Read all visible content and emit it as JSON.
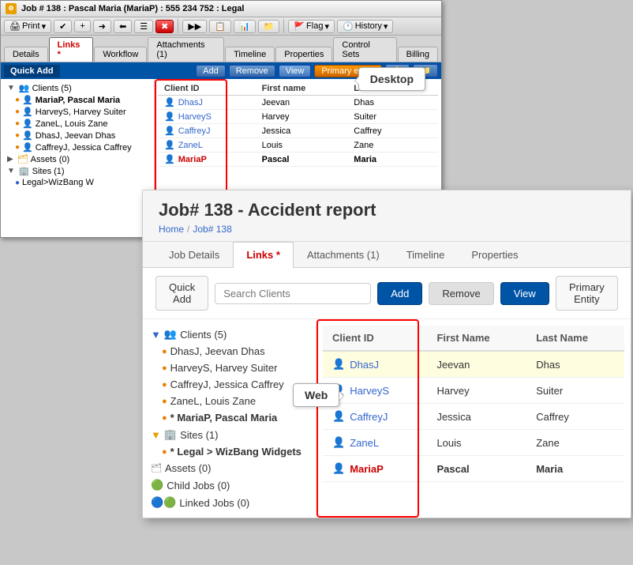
{
  "desktop": {
    "title": "Job # 138 : Pascal Maria (MariaP) : 555 234 752 : Legal",
    "toolbar": {
      "print": "Print",
      "flag": "Flag",
      "history": "History"
    },
    "tabs": [
      {
        "label": "Details",
        "active": false,
        "modified": false
      },
      {
        "label": "Links *",
        "active": true,
        "modified": true
      },
      {
        "label": "Workflow",
        "active": false,
        "modified": false
      },
      {
        "label": "Attachments (1)",
        "active": false,
        "modified": false
      },
      {
        "label": "Timeline",
        "active": false,
        "modified": false
      },
      {
        "label": "Properties",
        "active": false,
        "modified": false
      },
      {
        "label": "Control Sets",
        "active": false,
        "modified": false
      },
      {
        "label": "Billing",
        "active": false,
        "modified": false
      }
    ],
    "action_bar": {
      "quick_add": "Quick Add",
      "add": "Add",
      "remove": "Remove",
      "view": "View",
      "primary_entity": "Primary entity"
    },
    "tree": {
      "clients_label": "Clients (5)",
      "clients": [
        {
          "id": "MariaP",
          "name": "MariaP, Pascal Maria",
          "bold": true
        },
        {
          "id": "HarveyS",
          "name": "HarveyS, Harvey Suiter"
        },
        {
          "id": "ZaneL",
          "name": "ZaneL, Louis Zane"
        },
        {
          "id": "DhasJ",
          "name": "DhasJ, Jeevan Dhas"
        },
        {
          "id": "CaffreyJ",
          "name": "CaffreyJ, Jessica Caffrey"
        }
      ],
      "assets_label": "Assets (0)",
      "sites_label": "Sites (1)",
      "site_name": "Legal>WizBang W"
    },
    "table": {
      "headers": [
        "Client ID",
        "First name",
        "Last name"
      ],
      "rows": [
        {
          "id": "DhasJ",
          "first": "Jeevan",
          "last": "Dhas",
          "highlighted": false
        },
        {
          "id": "HarveyS",
          "first": "Harvey",
          "last": "Suiter",
          "highlighted": false
        },
        {
          "id": "CaffreyJ",
          "first": "Jessica",
          "last": "Caffrey",
          "highlighted": false
        },
        {
          "id": "ZaneL",
          "first": "Louis",
          "last": "Zane",
          "highlighted": false
        },
        {
          "id": "MariaP",
          "first": "Pascal",
          "last": "Maria",
          "bold": true,
          "highlighted": false
        }
      ]
    },
    "callout": "Desktop"
  },
  "web": {
    "title": "Job# 138 - Accident report",
    "breadcrumb": {
      "home": "Home",
      "sep": "/",
      "job": "Job# 138"
    },
    "tabs": [
      {
        "label": "Job Details",
        "active": false
      },
      {
        "label": "Links *",
        "active": true,
        "modified": true
      },
      {
        "label": "Attachments (1)",
        "active": false
      },
      {
        "label": "Timeline",
        "active": false
      },
      {
        "label": "Properties",
        "active": false
      }
    ],
    "action_bar": {
      "quick_add": "Quick Add",
      "search_placeholder": "Search Clients",
      "add": "Add",
      "remove": "Remove",
      "view": "View",
      "primary_entity": "Primary Entity"
    },
    "tree": {
      "clients_label": "Clients (5)",
      "clients": [
        {
          "id": "DhasJ",
          "name": "DhasJ, Jeevan Dhas"
        },
        {
          "id": "HarveyS",
          "name": "HarveyS, Harvey Suiter"
        },
        {
          "id": "CaffreyJ",
          "name": "CaffreyJ, Jessica Caffrey"
        },
        {
          "id": "ZaneL",
          "name": "ZaneL, Louis Zane"
        },
        {
          "id": "MariaP",
          "name": "* MariaP, Pascal Maria",
          "bold": true
        }
      ],
      "sites_label": "Sites (1)",
      "site_name": "* Legal > WizBang Widgets",
      "assets_label": "Assets (0)",
      "child_jobs": "Child Jobs (0)",
      "linked_jobs": "Linked Jobs (0)"
    },
    "table": {
      "headers": [
        "Client ID",
        "First Name",
        "Last Name"
      ],
      "rows": [
        {
          "id": "DhasJ",
          "first": "Jeevan",
          "last": "Dhas",
          "highlighted": true
        },
        {
          "id": "HarveyS",
          "first": "Harvey",
          "last": "Suiter",
          "highlighted": false
        },
        {
          "id": "CaffreyJ",
          "first": "Jessica",
          "last": "Caffrey",
          "highlighted": false
        },
        {
          "id": "ZaneL",
          "first": "Louis",
          "last": "Zane",
          "highlighted": false
        },
        {
          "id": "MariaP",
          "first": "Pascal",
          "last": "Maria",
          "bold": true,
          "highlighted": false
        }
      ]
    },
    "callout": "Web"
  }
}
